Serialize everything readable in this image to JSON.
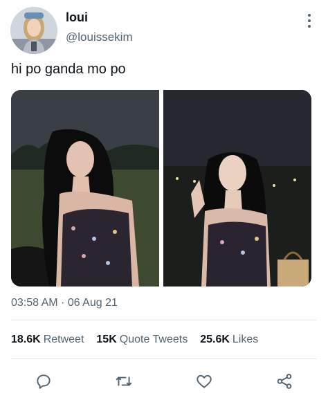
{
  "user": {
    "display_name": "loui",
    "handle": "@louissekim",
    "avatar_icon": "profile-photo"
  },
  "tweet": {
    "text": "hi po ganda mo po",
    "timestamp": "03:58 AM · 06 Aug 21",
    "media_count": 2
  },
  "stats": {
    "retweets_count": "18.6K",
    "retweets_label": "Retweet",
    "quotes_count": "15K",
    "quotes_label": "Quote Tweets",
    "likes_count": "25.6K",
    "likes_label": "Likes"
  },
  "actions": [
    "reply-icon",
    "retweet-icon",
    "like-icon",
    "share-icon"
  ],
  "colors": {
    "text_primary": "#0f1419",
    "text_secondary": "#536471",
    "divider": "#e6e9ec"
  }
}
